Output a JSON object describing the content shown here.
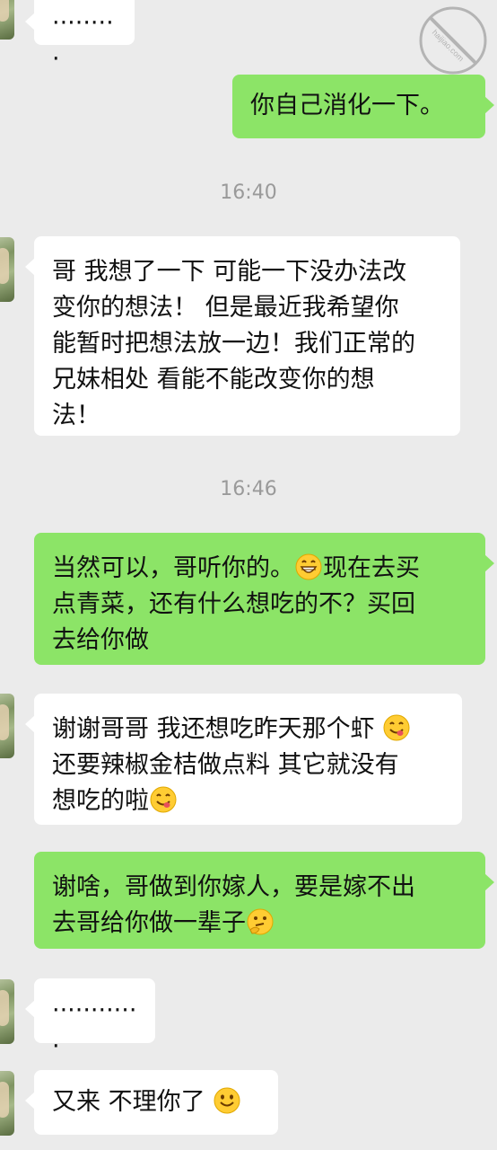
{
  "colors": {
    "background": "#ebebeb",
    "incoming_bubble": "#ffffff",
    "outgoing_bubble": "#8ce467",
    "timestamp": "#9a9a9a"
  },
  "watermark": {
    "icon": "circled-slash-logo-icon",
    "text": "haijiao.com"
  },
  "messages": [
    {
      "sender": "contact",
      "text": "·········"
    },
    {
      "sender": "me",
      "text": "你自己消化一下。"
    },
    {
      "time": "16:40"
    },
    {
      "sender": "contact",
      "lines": [
        "哥 我想了一下 可能一下没办法改",
        "变你的想法！ 但是最近我希望你",
        "能暂时把想法放一边！我们正常的",
        "兄妹相处  看能不能改变你的想",
        "法！"
      ]
    },
    {
      "time": "16:46"
    },
    {
      "sender": "me",
      "lines": [
        "当然可以，哥听你的。",
        "现在去买",
        "点青菜，还有什么想吃的不？买回",
        "去给你做"
      ],
      "emoji": "grinning-face-icon"
    },
    {
      "sender": "contact",
      "lines": [
        "谢谢哥哥 我还想吃昨天那个虾",
        "还要辣椒金桔做点料 其它就没有",
        "想吃的啦"
      ],
      "emoji": "yum-face-icon"
    },
    {
      "sender": "me",
      "lines": [
        "谢啥，哥做到你嫁人，要是嫁不出",
        "去哥给你做一辈子"
      ],
      "emoji": "thinking-face-icon"
    },
    {
      "sender": "contact",
      "text": "············"
    },
    {
      "sender": "contact",
      "text": "又来 不理你了",
      "emoji": "smiling-face-icon"
    }
  ]
}
